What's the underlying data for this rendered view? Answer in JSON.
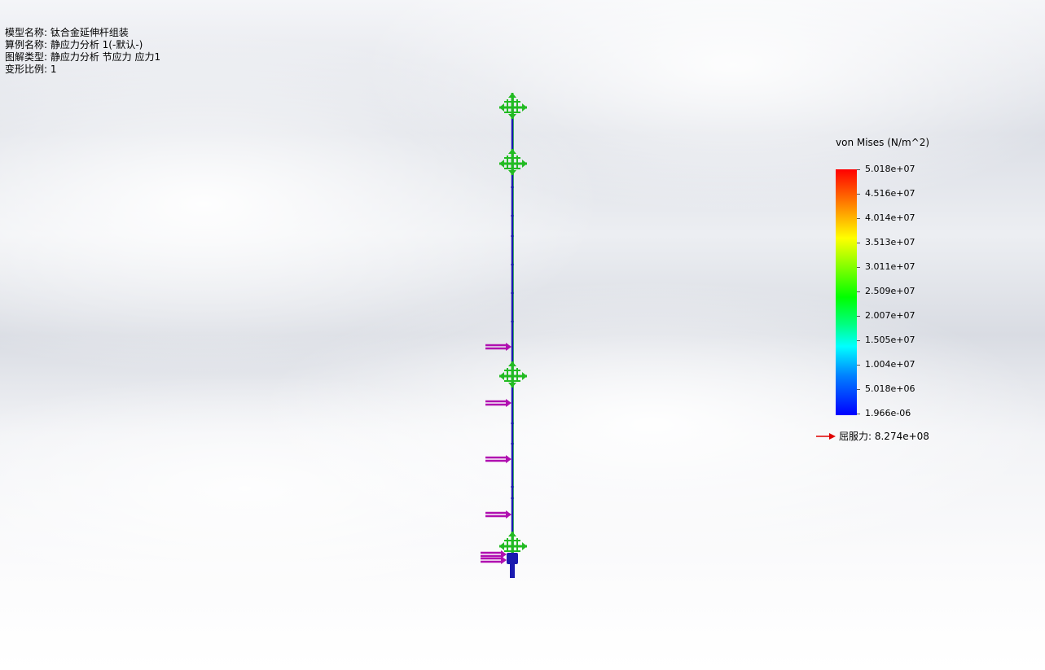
{
  "info": {
    "model_name": "模型名称: 钛合金延伸杆组装",
    "study_name": "算例名称: 静应力分析 1(-默认-)",
    "plot_type": "图解类型: 静应力分析 节应力 应力1",
    "deformation_scale": "变形比例: 1"
  },
  "legend": {
    "title": "von Mises (N/m^2)",
    "values": [
      "5.018e+07",
      "4.516e+07",
      "4.014e+07",
      "3.513e+07",
      "3.011e+07",
      "2.509e+07",
      "2.007e+07",
      "1.505e+07",
      "1.004e+07",
      "5.018e+06",
      "1.966e-06"
    ],
    "colorbar_colors": [
      "#ff0000",
      "#ff8000",
      "#ffff00",
      "#80ff00",
      "#00ff00",
      "#00ff80",
      "#00ffff",
      "#0080ff",
      "#0000ff"
    ],
    "yield_strength": "屈服力: 8.274e+08",
    "yield_arrow_color": "#e00000"
  },
  "model": {
    "rod_color": "#1a1ab0",
    "fixture_color": "#22bb22",
    "load_arrow_color": "#b010b0",
    "fixture_icon": "fixed-geometry-icon",
    "load_icon": "force-arrow-icon"
  }
}
